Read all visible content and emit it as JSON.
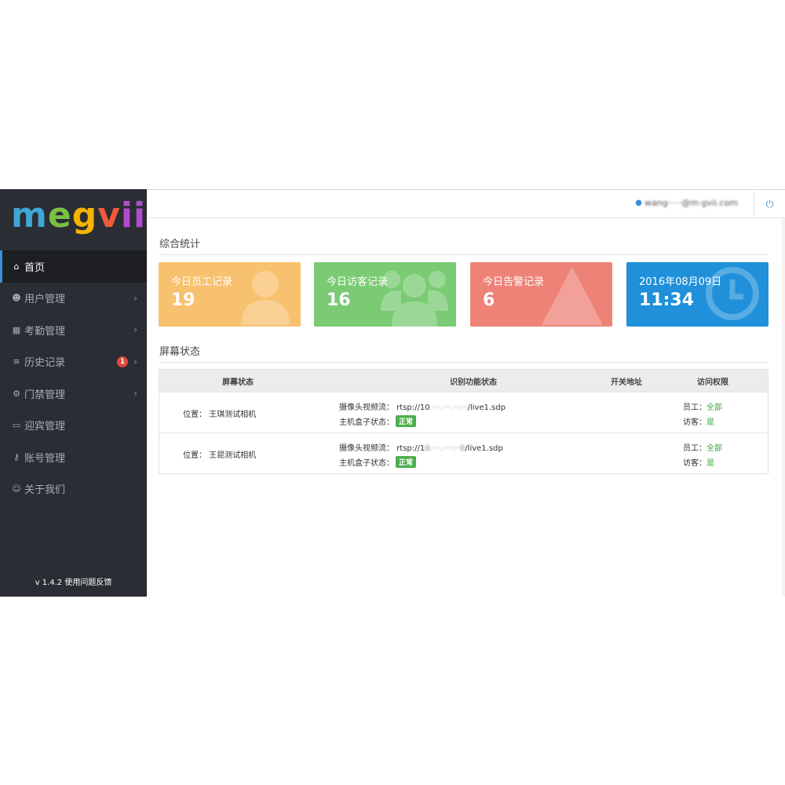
{
  "brand": {
    "logo_parts": [
      "m",
      "e",
      "g",
      "v",
      "ii"
    ]
  },
  "sidebar": {
    "items": [
      {
        "label": "首页",
        "icon": "home-icon",
        "active": true
      },
      {
        "label": "用户管理",
        "icon": "users-icon"
      },
      {
        "label": "考勤管理",
        "icon": "table-icon"
      },
      {
        "label": "历史记录",
        "icon": "list-icon",
        "badge": "1"
      },
      {
        "label": "门禁管理",
        "icon": "cogs-icon"
      },
      {
        "label": "迎宾管理",
        "icon": "desktop-icon"
      },
      {
        "label": "账号管理",
        "icon": "key-icon"
      },
      {
        "label": "关于我们",
        "icon": "smile-icon"
      }
    ],
    "version": "v 1.4.2 使用问题反馈"
  },
  "topbar": {
    "user_email": "wang·····@m·gvii.com"
  },
  "overview": {
    "title": "综合统计",
    "cards": [
      {
        "title": "今日员工记录",
        "value": "19",
        "color": "#f8c16f"
      },
      {
        "title": "今日访客记录",
        "value": "16",
        "color": "#7acb74"
      },
      {
        "title": "今日告警记录",
        "value": "6",
        "color": "#ee8277"
      },
      {
        "title": "2016年08月09日",
        "value": "11:34",
        "color": "#1f90d9"
      }
    ]
  },
  "screens": {
    "title": "屏幕状态",
    "headers": [
      "屏幕状态",
      "识别功能状态",
      "开关地址",
      "访问权限"
    ],
    "rows": [
      {
        "location": "位置：  王琪测试相机",
        "camera_label": "摄像头视频流：",
        "camera_prefix": "rtsp://10",
        "camera_hidden": ".···.···.···:··",
        "camera_suffix": "/live1.sdp",
        "box_label": "主机盒子状态：",
        "box_status": "正常",
        "staff_label": "员工：",
        "staff_value": "全部",
        "visitor_label": "访客：",
        "visitor_value": "是"
      },
      {
        "location": "位置：  王昆测试相机",
        "camera_label": "摄像头视频流：",
        "camera_prefix": "rtsp://1",
        "camera_hidden": "0.···.····:··0",
        "camera_suffix": "/live1.sdp",
        "box_label": "主机盒子状态：",
        "box_status": "正常",
        "staff_label": "员工：",
        "staff_value": "全部",
        "visitor_label": "访客：",
        "visitor_value": "是"
      }
    ]
  }
}
